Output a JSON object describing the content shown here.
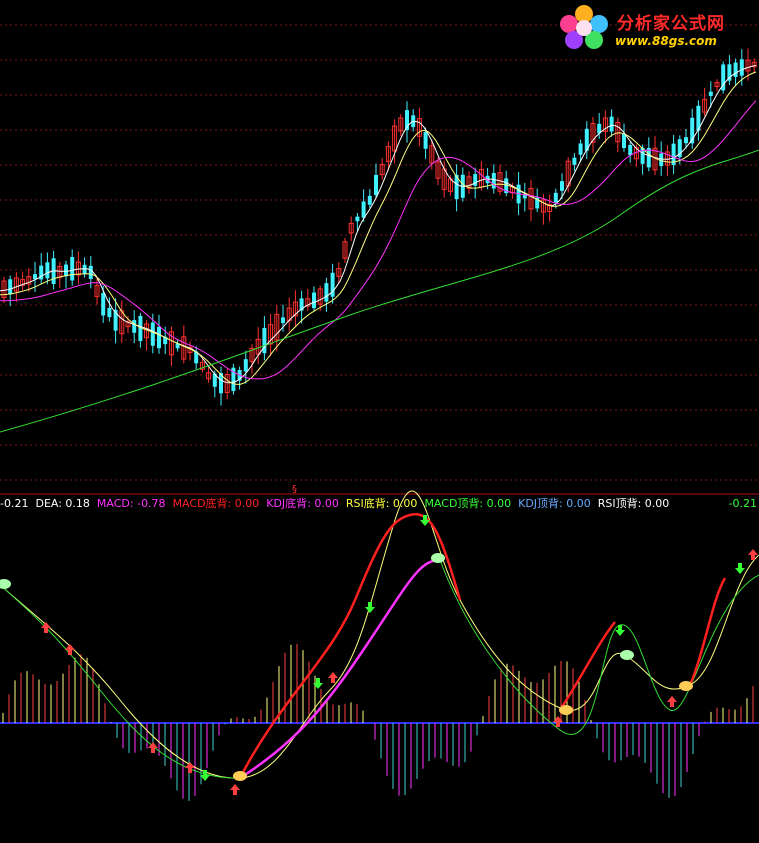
{
  "logo": {
    "title": "分析家公式网",
    "url": "www.88gs.com"
  },
  "divider_marker": "§",
  "indicator_status": [
    {
      "label": "-0.21",
      "color": "#ffffff"
    },
    {
      "label": "DEA: 0.18",
      "color": "#ffffff"
    },
    {
      "label": "MACD: -0.78",
      "color": "#ff33ff"
    },
    {
      "label": "MACD底背: 0.00",
      "color": "#ff2020"
    },
    {
      "label": "KDJ底背: 0.00",
      "color": "#ff33ff"
    },
    {
      "label": "RSI底背: 0.00",
      "color": "#ffff40"
    },
    {
      "label": "MACD顶背: 0.00",
      "color": "#33ff33"
    },
    {
      "label": "KDJ顶背: 0.00",
      "color": "#66aaff"
    },
    {
      "label": "RSI顶背: 0.00",
      "color": "#ffffff"
    }
  ],
  "indicator_status_right": "-0.21",
  "colors": {
    "background": "#000000",
    "grid": "#7a1a1a",
    "divider": "#b01010",
    "up_candle": "#ff3030",
    "down_candle": "#40f0ff",
    "ma_short": "#ffffff",
    "ma_mid": "#ffff80",
    "ma_long": "#ff33ff",
    "ma_longest": "#33dd33",
    "zero_line": "#3030ff"
  }
}
